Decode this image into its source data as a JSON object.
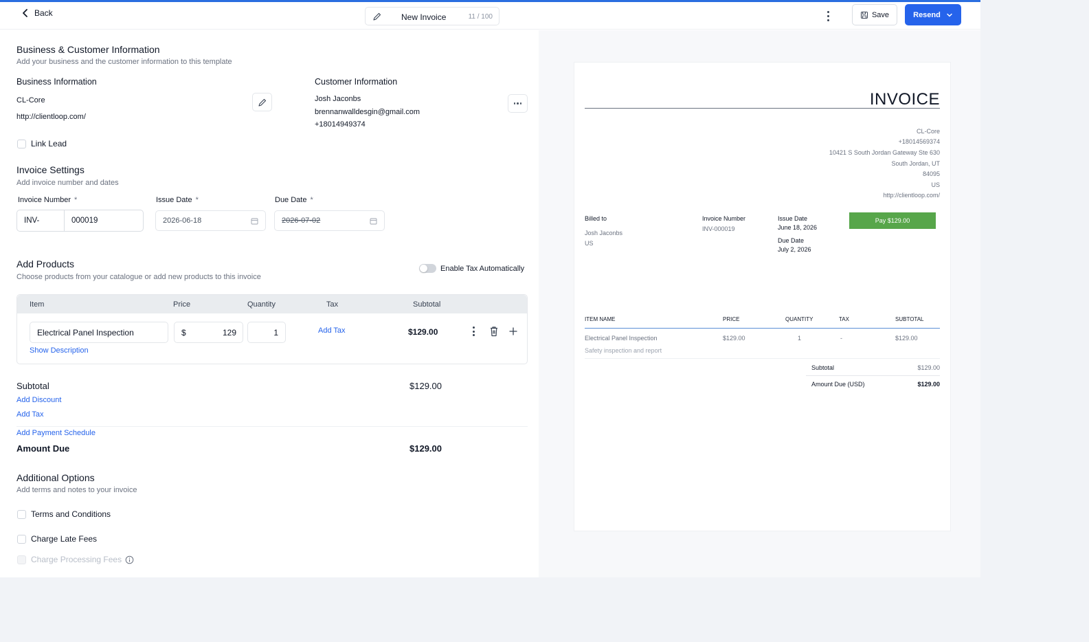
{
  "topbar": {
    "back_label": "Back",
    "title": "New Invoice",
    "title_count": "11 / 100",
    "save_label": "Save",
    "resend_label": "Resend"
  },
  "business_customer": {
    "heading": "Business & Customer Information",
    "subtitle": "Add your business and the customer information to this template",
    "business_heading": "Business Information",
    "business_name": "CL-Core",
    "business_url": "http://clientloop.com/",
    "customer_heading": "Customer Information",
    "customer_name": "Josh Jaconbs",
    "customer_email": "brennanwalldesgin@gmail.com",
    "customer_phone": "+18014949374",
    "link_lead_label": "Link Lead"
  },
  "invoice_settings": {
    "heading": "Invoice Settings",
    "subtitle": "Add invoice number and dates",
    "invoice_number_label": "Invoice Number",
    "invoice_prefix": "INV-",
    "invoice_number": "000019",
    "issue_date_label": "Issue Date",
    "issue_date": "2026-06-18",
    "due_date_label": "Due Date",
    "due_date": "2026-07-02",
    "required_mark": "*"
  },
  "products": {
    "heading": "Add Products",
    "subtitle": "Choose products from your catalogue or add new products to this invoice",
    "enable_tax_label": "Enable Tax Automatically",
    "enable_tax_on": false,
    "columns": [
      "Item",
      "Price",
      "Quantity",
      "Tax",
      "Subtotal"
    ],
    "rows": [
      {
        "item": "Electrical Panel Inspection",
        "currency": "$",
        "price": "129",
        "quantity": "1",
        "tax_link": "Add Tax",
        "subtotal": "$129.00",
        "show_description": "Show Description"
      }
    ]
  },
  "totals": {
    "subtotal_label": "Subtotal",
    "subtotal_value": "$129.00",
    "add_discount": "Add Discount",
    "add_tax": "Add Tax",
    "add_payment_schedule": "Add Payment Schedule",
    "amount_due_label": "Amount Due",
    "amount_due_value": "$129.00"
  },
  "additional": {
    "heading": "Additional Options",
    "subtitle": "Add terms and notes to your invoice",
    "terms_label": "Terms and Conditions",
    "late_fees_label": "Charge Late Fees",
    "processing_fees_label": "Charge Processing Fees"
  },
  "preview": {
    "title": "INVOICE",
    "business_lines": [
      "CL-Core",
      "+18014569374",
      "10421 S South Jordan Gateway Ste 630",
      "South Jordan, UT",
      "84095",
      "US",
      "http://clientloop.com/"
    ],
    "billed_to_label": "Billed to",
    "billed_to_name": "Josh Jaconbs",
    "billed_to_country": "US",
    "invoice_number_label": "Invoice Number",
    "invoice_number": "INV-000019",
    "issue_date_label": "Issue Date",
    "issue_date": "June 18, 2026",
    "due_date_label": "Due Date",
    "due_date": "July 2, 2026",
    "pay_button": "Pay $129.00",
    "columns": [
      "ITEM NAME",
      "PRICE",
      "QUANTITY",
      "TAX",
      "SUBTOTAL"
    ],
    "item_name": "Electrical Panel Inspection",
    "item_description": "Safety inspection and report",
    "item_price": "$129.00",
    "item_quantity": "1",
    "item_tax": "-",
    "item_subtotal": "$129.00",
    "subtotal_label": "Subtotal",
    "subtotal_value": "$129.00",
    "amount_due_label": "Amount Due (USD)",
    "amount_due_value": "$129.00"
  },
  "colors": {
    "accent": "#2563eb",
    "pay_green": "#57a64a",
    "top_progress": "#2b6ee0"
  }
}
